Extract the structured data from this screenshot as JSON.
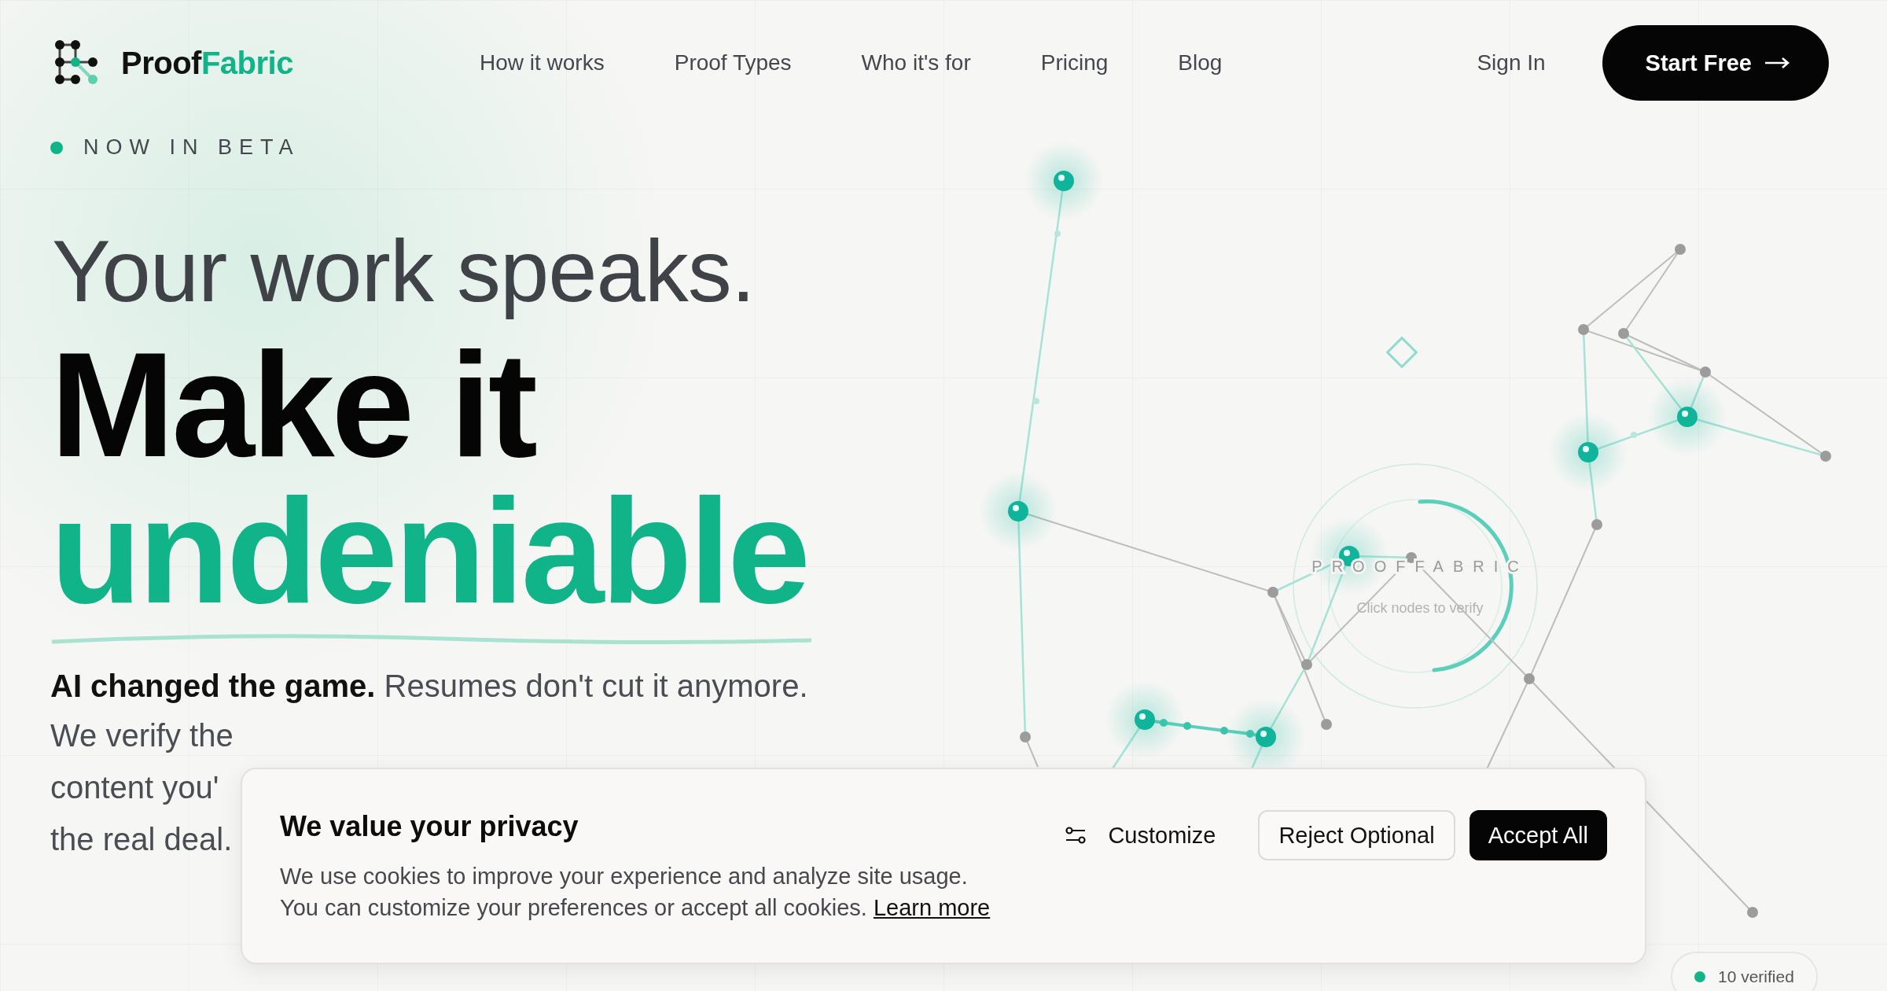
{
  "nav": {
    "logo": {
      "first": "Proof",
      "second": "Fabric"
    },
    "links": [
      {
        "label": "How it works"
      },
      {
        "label": "Proof Types"
      },
      {
        "label": "Who it's for"
      },
      {
        "label": "Pricing"
      },
      {
        "label": "Blog"
      }
    ],
    "sign_in": "Sign In",
    "cta": "Start Free"
  },
  "hero": {
    "badge": "NOW IN BETA",
    "headline_1": "Your work speaks.",
    "headline_2": "Make it",
    "headline_3": "undeniable",
    "intro": "**AI changed the game.** Resumes don't cut it anymore.",
    "intro_lines": [
      "We verify the",
      "content you'",
      "the real deal."
    ]
  },
  "network": {
    "title": "PROOFFABRIC",
    "hint": "Click nodes to verify",
    "status": "10 verified"
  },
  "cookie_banner": {
    "title": "We value your privacy",
    "lines": [
      "We use cookies to improve your experience and analyze site usage.",
      "You can customize your preferences or accept all cookies."
    ],
    "link": "Learn more",
    "customize": "Customize",
    "reject": "Reject Optional",
    "accept": "Accept All"
  }
}
